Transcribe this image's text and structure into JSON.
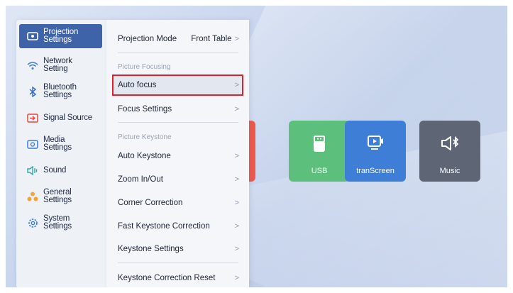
{
  "sidebar": {
    "items": [
      {
        "label": "Projection Settings",
        "line1": "Projection",
        "line2": "Settings",
        "icon": "projector-icon",
        "active": true
      },
      {
        "label": "Network Setting",
        "line1": "Network",
        "line2": "Setting",
        "icon": "wifi-icon"
      },
      {
        "label": "Bluetooth Settings",
        "line1": "Bluetooth",
        "line2": "Settings",
        "icon": "bluetooth-icon"
      },
      {
        "label": "Signal Source",
        "line1": "Signal Source",
        "line2": "",
        "icon": "signal-source-icon"
      },
      {
        "label": "Media Settings",
        "line1": "Media",
        "line2": "Settings",
        "icon": "media-icon"
      },
      {
        "label": "Sound",
        "line1": "Sound",
        "line2": "",
        "icon": "sound-icon"
      },
      {
        "label": "General Settings",
        "line1": "General",
        "line2": "Settings",
        "icon": "general-icon"
      },
      {
        "label": "System Settings",
        "line1": "System",
        "line2": "Settings",
        "icon": "system-gear-icon"
      }
    ]
  },
  "panel": {
    "projection_mode": {
      "label": "Projection Mode",
      "value": "Front Table"
    },
    "section_focus": "Picture Focusing",
    "auto_focus": "Auto focus",
    "focus_settings": "Focus Settings",
    "section_keystone": "Picture Keystone",
    "auto_keystone": "Auto Keystone",
    "zoom": "Zoom In/Out",
    "corner_correction": "Corner Correction",
    "fast_keystone": "Fast Keystone Correction",
    "keystone_settings": "Keystone Settings",
    "keystone_reset": "Keystone Correction Reset",
    "chevron": ">"
  },
  "tiles": {
    "usb": "USB",
    "transcreen": "tranScreen",
    "music": "Music"
  },
  "colors": {
    "accent": "#3e63a8",
    "highlight_border": "#e0202a",
    "usb": "#5cc07c",
    "transcreen": "#3f7ed6",
    "music": "#5e6675"
  }
}
